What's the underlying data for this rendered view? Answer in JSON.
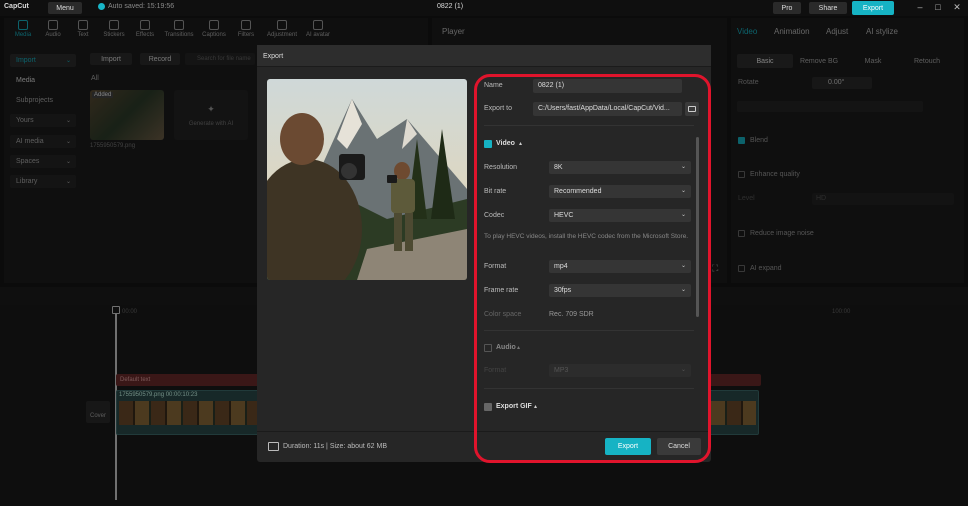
{
  "titlebar": {
    "app": "CapCut",
    "menu": "Menu",
    "autosave": "Auto saved: 15:19:56",
    "project": "0822 (1)",
    "pro": "Pro",
    "share": "Share",
    "export": "Export"
  },
  "toolbar": {
    "tabs": [
      "Media",
      "Audio",
      "Text",
      "Stickers",
      "Effects",
      "Transitions",
      "Captions",
      "Filters",
      "Adjustment",
      "AI avatar"
    ]
  },
  "sidebar": {
    "items": [
      "Import",
      "Media",
      "Subprojects",
      "Yours",
      "AI media",
      "Spaces",
      "Library"
    ]
  },
  "media": {
    "import": "Import",
    "record": "Record",
    "search_placeholder": "Search for file name",
    "filter_all": "All",
    "thumb_badge": "Added",
    "thumb_name": "1755950579.png",
    "generate": "Generate with AI"
  },
  "player": {
    "title": "Player"
  },
  "right": {
    "tabs": [
      "Video",
      "Animation",
      "Adjust",
      "AI stylize"
    ],
    "subtabs": [
      "Basic",
      "Remove BG",
      "Mask",
      "Retouch"
    ],
    "rotate_label": "Rotate",
    "rotate_value": "0.00°",
    "blend": "Blend",
    "enhance": "Enhance quality",
    "level_label": "Level",
    "level_value": "HD",
    "noise": "Reduce image noise",
    "expand": "AI expand"
  },
  "timeline": {
    "text_clip": "Default text",
    "video_clip": "1755950579.png  00:00:10:23",
    "cover": "Cover",
    "time_start": "00:00",
    "time_end": "100:00"
  },
  "dialog": {
    "title": "Export",
    "name_label": "Name",
    "name_value": "0822 (1)",
    "exportto_label": "Export to",
    "exportto_value": "C:/Users/fast/AppData/Local/CapCut/Vid...",
    "video_section": "Video",
    "resolution_label": "Resolution",
    "resolution_value": "8K",
    "bitrate_label": "Bit rate",
    "bitrate_value": "Recommended",
    "codec_label": "Codec",
    "codec_value": "HEVC",
    "hevc_note": "To play HEVC videos, install the HEVC codec from the Microsoft Store.",
    "format_label": "Format",
    "format_value": "mp4",
    "framerate_label": "Frame rate",
    "framerate_value": "30fps",
    "colorspace_label": "Color space",
    "colorspace_value": "Rec. 709 SDR",
    "audio_section": "Audio",
    "audio_format_label": "Format",
    "audio_format_value": "MP3",
    "gif_section": "Export GIF",
    "duration": "Duration: 11s | Size: about 62 MB",
    "export_btn": "Export",
    "cancel_btn": "Cancel"
  },
  "colors": {
    "accent": "#16b3c4",
    "highlight": "#e0142c"
  }
}
